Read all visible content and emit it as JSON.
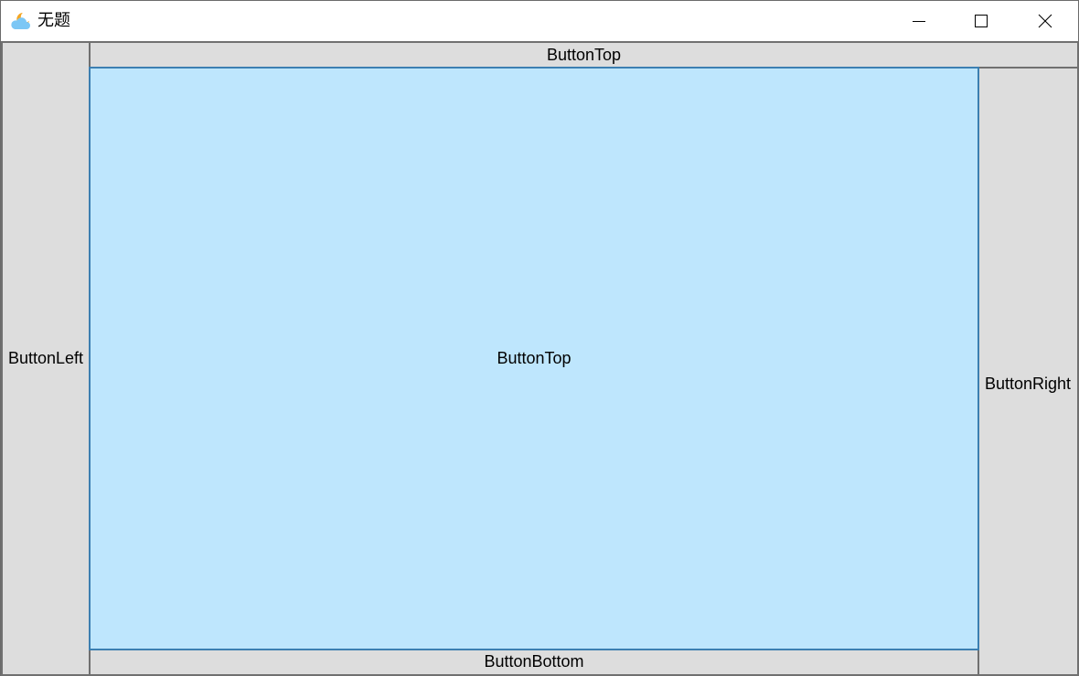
{
  "window": {
    "title": "无题",
    "app_icon": "weather-cloud-sun-icon",
    "controls": {
      "minimize": "minimize-icon",
      "maximize": "maximize-icon",
      "close": "close-icon"
    }
  },
  "dock": {
    "left_label": "ButtonLeft",
    "top_label": "ButtonTop",
    "right_label": "ButtonRight",
    "bottom_label": "ButtonBottom",
    "fill_label": "ButtonTop"
  },
  "colors": {
    "button_face": "#dddddd",
    "button_border": "#707070",
    "fill_hover_face": "#bee6fd",
    "fill_hover_border": "#3c7fb1"
  }
}
